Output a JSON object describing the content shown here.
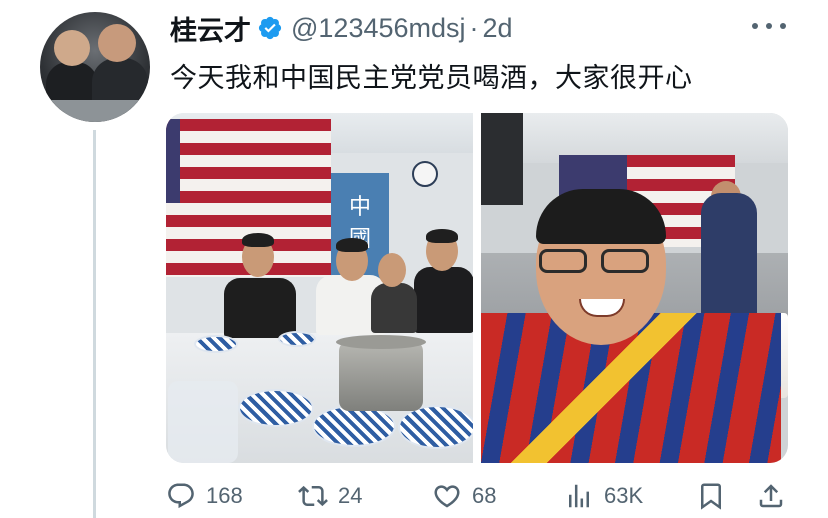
{
  "tweet": {
    "author_name": "桂云才",
    "handle": "@123456mdsj",
    "separator": "·",
    "time": "2d",
    "text": "今天我和中国民主党党员喝酒，大家很开心"
  },
  "media": {
    "left_photo": {
      "banner_text": "中\n國"
    }
  },
  "actions": {
    "reply_count": "168",
    "retweet_count": "24",
    "like_count": "68",
    "views_count": "63K"
  },
  "colors": {
    "verified": "#1d9bf0",
    "secondary_text": "#536471",
    "primary_text": "#0f1419"
  },
  "icons": [
    "verified-badge-icon",
    "more-icon",
    "reply-icon",
    "retweet-icon",
    "like-icon",
    "views-icon",
    "bookmark-icon",
    "share-icon"
  ]
}
